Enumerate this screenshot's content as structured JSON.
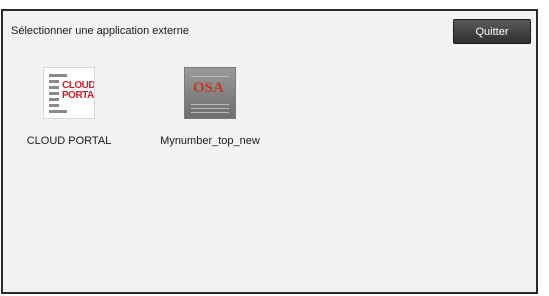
{
  "header": {
    "title": "Sélectionner une application externe",
    "quit_label": "Quitter"
  },
  "apps": [
    {
      "label": "CLOUD PORTAL",
      "icon": "cloud-portal-icon",
      "logo_line1": "CLOUD",
      "logo_line2": "PORTAL",
      "accent": "#d01d2a"
    },
    {
      "label": "Mynumber_top_new",
      "icon": "mynumber-icon",
      "logo_text": "OSA",
      "accent": "#c0392b"
    }
  ]
}
